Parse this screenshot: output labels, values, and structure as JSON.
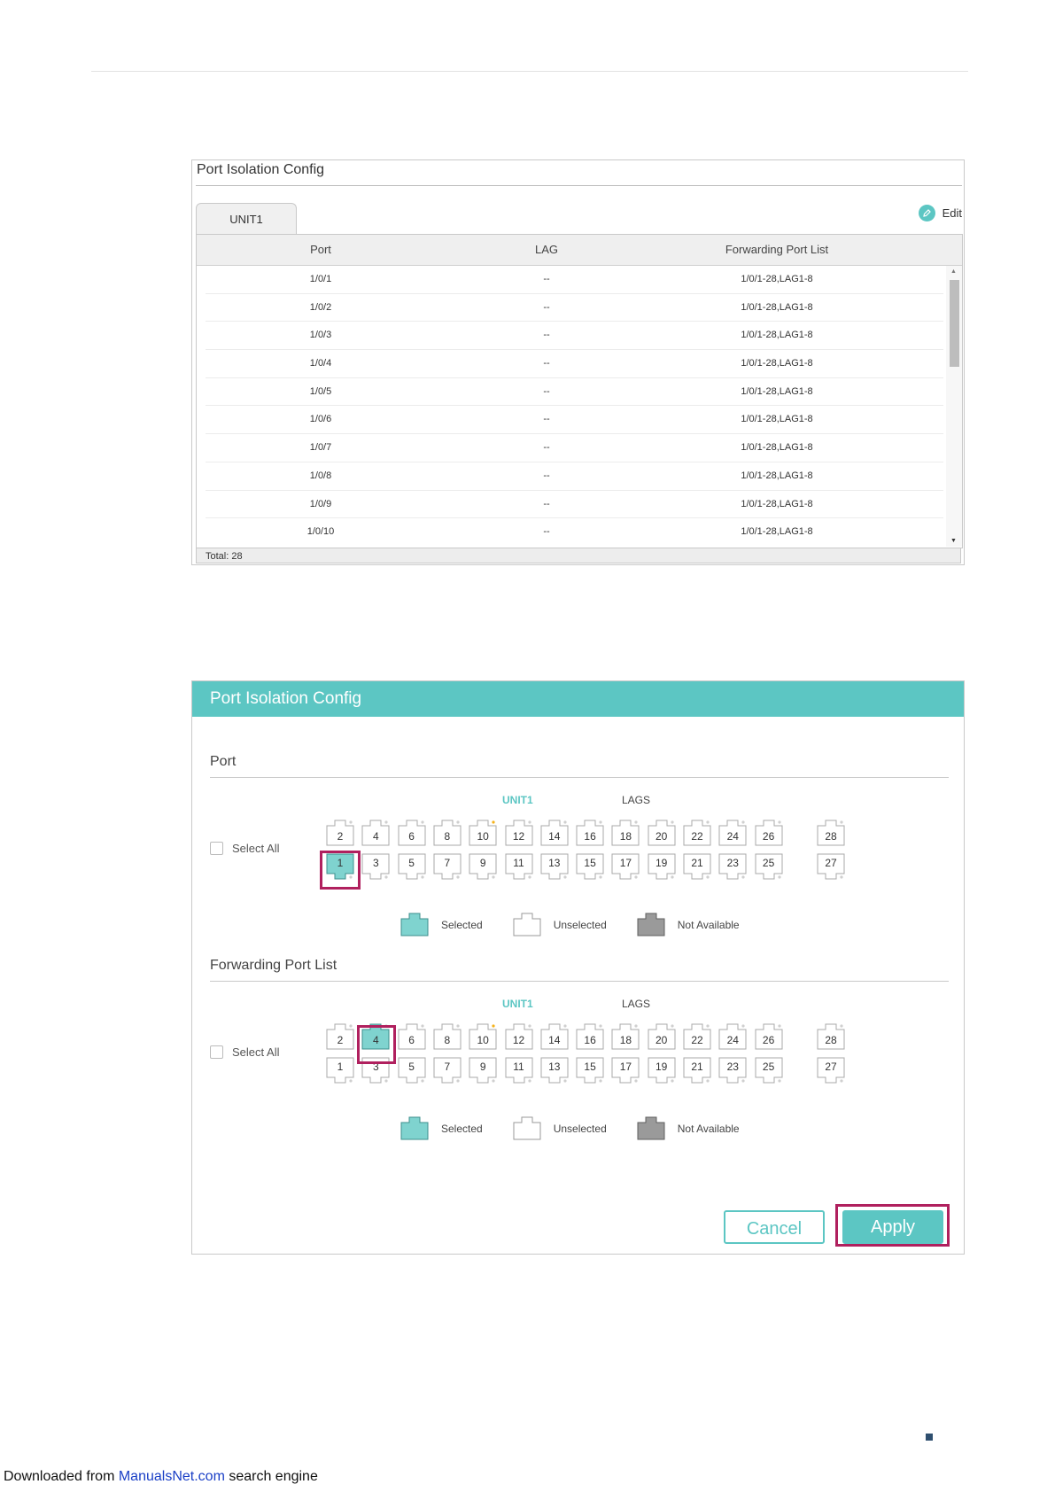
{
  "panel1": {
    "title": "Port Isolation Config",
    "tab": "UNIT1",
    "edit_label": "Edit",
    "columns": [
      "Port",
      "LAG",
      "Forwarding Port List"
    ],
    "rows": [
      {
        "port": "1/0/1",
        "lag": "--",
        "fwd": "1/0/1-28,LAG1-8"
      },
      {
        "port": "1/0/2",
        "lag": "--",
        "fwd": "1/0/1-28,LAG1-8"
      },
      {
        "port": "1/0/3",
        "lag": "--",
        "fwd": "1/0/1-28,LAG1-8"
      },
      {
        "port": "1/0/4",
        "lag": "--",
        "fwd": "1/0/1-28,LAG1-8"
      },
      {
        "port": "1/0/5",
        "lag": "--",
        "fwd": "1/0/1-28,LAG1-8"
      },
      {
        "port": "1/0/6",
        "lag": "--",
        "fwd": "1/0/1-28,LAG1-8"
      },
      {
        "port": "1/0/7",
        "lag": "--",
        "fwd": "1/0/1-28,LAG1-8"
      },
      {
        "port": "1/0/8",
        "lag": "--",
        "fwd": "1/0/1-28,LAG1-8"
      },
      {
        "port": "1/0/9",
        "lag": "--",
        "fwd": "1/0/1-28,LAG1-8"
      },
      {
        "port": "1/0/10",
        "lag": "--",
        "fwd": "1/0/1-28,LAG1-8"
      }
    ],
    "total": "Total: 28"
  },
  "panel2": {
    "title": "Port Isolation Config",
    "port_section": {
      "title": "Port",
      "unit_label": "UNIT1",
      "lags_label": "LAGS",
      "select_all": "Select All",
      "top_row": [
        "2",
        "4",
        "6",
        "8",
        "10",
        "12",
        "14",
        "16",
        "18",
        "20",
        "22",
        "24",
        "26"
      ],
      "bottom_row": [
        "1",
        "3",
        "5",
        "7",
        "9",
        "11",
        "13",
        "15",
        "17",
        "19",
        "21",
        "23",
        "25"
      ],
      "sfp_top": "28",
      "sfp_bottom": "27",
      "selected": [
        "1"
      ]
    },
    "fwd_section": {
      "title": "Forwarding Port List",
      "unit_label": "UNIT1",
      "lags_label": "LAGS",
      "select_all": "Select All",
      "top_row": [
        "2",
        "4",
        "6",
        "8",
        "10",
        "12",
        "14",
        "16",
        "18",
        "20",
        "22",
        "24",
        "26"
      ],
      "bottom_row": [
        "1",
        "3",
        "5",
        "7",
        "9",
        "11",
        "13",
        "15",
        "17",
        "19",
        "21",
        "23",
        "25"
      ],
      "sfp_top": "28",
      "sfp_bottom": "27",
      "selected": [
        "4"
      ]
    },
    "legend": {
      "selected": "Selected",
      "unselected": "Unselected",
      "not_available": "Not Available"
    },
    "cancel_label": "Cancel",
    "apply_label": "Apply"
  },
  "colors": {
    "accent": "#5cc6c3",
    "highlight": "#b0205e",
    "port_selected": "#7fd3cf",
    "port_na": "#9a9a9a",
    "status_dot": "#f5b21a"
  },
  "footer": {
    "prefix": "Downloaded from ",
    "link": "ManualsNet.com",
    "suffix": " search engine"
  }
}
